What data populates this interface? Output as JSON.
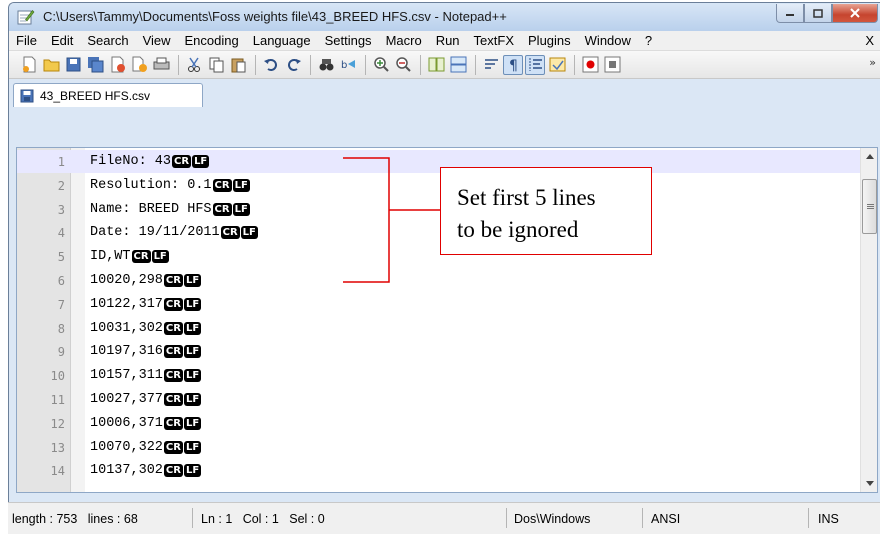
{
  "window": {
    "title": "C:\\Users\\Tammy\\Documents\\Foss weights file\\43_BREED HFS.csv - Notepad++"
  },
  "menu": [
    "File",
    "Edit",
    "Search",
    "View",
    "Encoding",
    "Language",
    "Settings",
    "Macro",
    "Run",
    "TextFX",
    "Plugins",
    "Window",
    "?"
  ],
  "menu_close": "X",
  "toolbar_more": "»",
  "tab": {
    "label": "43_BREED HFS.csv"
  },
  "editor": {
    "eol_cr": "CR",
    "eol_lf": "LF",
    "lines": [
      {
        "num": "1",
        "text": "FileNo: 43"
      },
      {
        "num": "2",
        "text": "Resolution: 0.1"
      },
      {
        "num": "3",
        "text": "Name: BREED HFS"
      },
      {
        "num": "4",
        "text": "Date: 19/11/2011"
      },
      {
        "num": "5",
        "text": "ID,WT"
      },
      {
        "num": "6",
        "text": "10020,298"
      },
      {
        "num": "7",
        "text": "10122,317"
      },
      {
        "num": "8",
        "text": "10031,302"
      },
      {
        "num": "9",
        "text": "10197,316"
      },
      {
        "num": "10",
        "text": "10157,311"
      },
      {
        "num": "11",
        "text": "10027,377"
      },
      {
        "num": "12",
        "text": "10006,371"
      },
      {
        "num": "13",
        "text": "10070,322"
      },
      {
        "num": "14",
        "text": "10137,302"
      }
    ]
  },
  "annotation": {
    "line1": "Set first 5 lines",
    "line2": "to be ignored"
  },
  "status": {
    "length": "length : 753   lines : 68",
    "position": "Ln : 1   Col : 1   Sel : 0",
    "eol_format": "Dos\\Windows",
    "encoding": "ANSI",
    "mode": "INS"
  },
  "colors": {
    "annotation_border": "#e00000",
    "current_line": "#e8e8ff",
    "eol_badge": "#000000"
  }
}
